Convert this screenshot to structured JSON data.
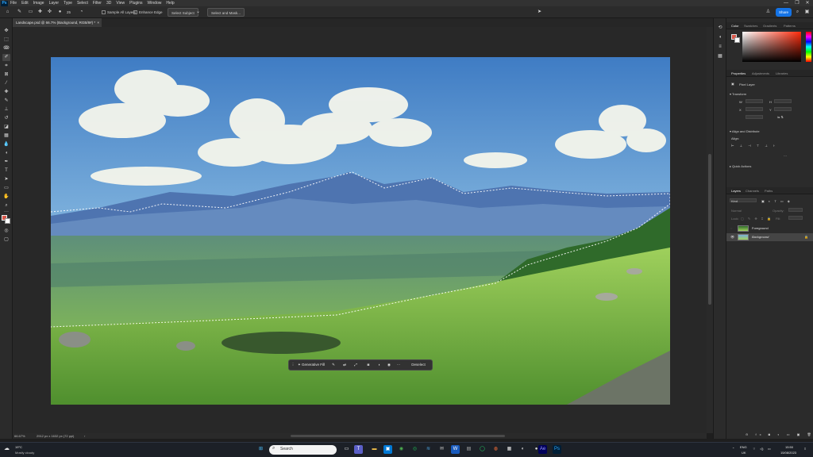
{
  "app": {
    "logo": "Ps",
    "menu": [
      "File",
      "Edit",
      "Image",
      "Layer",
      "Type",
      "Select",
      "Filter",
      "3D",
      "View",
      "Plugins",
      "Window",
      "Help"
    ],
    "window_controls": [
      "—",
      "❐",
      "✕"
    ]
  },
  "options_bar": {
    "brush_size": "25",
    "sample_all_layers": "Sample All Layers",
    "enhance_edge": "Enhance Edge",
    "select_subject": "Select Subject",
    "select_and_mask": "Select and Mask...",
    "share": "Share"
  },
  "document": {
    "tab_title": "Landscape.psd @ 66.7% (Background, RGB/8#) *",
    "close": "×"
  },
  "contextual_bar": {
    "generative_fill": "Generative Fill",
    "deselect": "Deselect",
    "more": "···"
  },
  "status": {
    "zoom": "66.67%",
    "info": "2912 px x 1632 px (72 ppi)",
    "arrow": "›"
  },
  "panels": {
    "color_tabs": [
      "Color",
      "Swatches",
      "Gradients",
      "Patterns"
    ],
    "properties_tabs": [
      "Properties",
      "Adjustments",
      "Libraries"
    ],
    "pixel_layer": "Pixel Layer",
    "transform": "Transform",
    "transform_fields": [
      "W",
      "H",
      "X",
      "Y"
    ],
    "align": "Align and Distribute",
    "align_label": "Align:",
    "quick_actions": "Quick Actions",
    "layers_tabs": [
      "Layers",
      "Channels",
      "Paths"
    ],
    "kind": "Kind",
    "normal": "Normal",
    "opacity": "Opacity:",
    "lock": "Lock:",
    "fill": "Fill:",
    "layers": [
      {
        "name": "Foreground",
        "visible": false
      },
      {
        "name": "Background",
        "visible": true,
        "selected": true
      }
    ]
  },
  "taskbar": {
    "weather_temp": "19°C",
    "weather_desc": "Mostly cloudy",
    "search_placeholder": "Search",
    "lang_line1": "ENG",
    "lang_line2": "UK",
    "time": "15:50",
    "date": "15/08/2023"
  },
  "colors": {
    "accent": "#1473e6",
    "foreground_color": "#d9574a",
    "background_color": "#ffffff"
  }
}
